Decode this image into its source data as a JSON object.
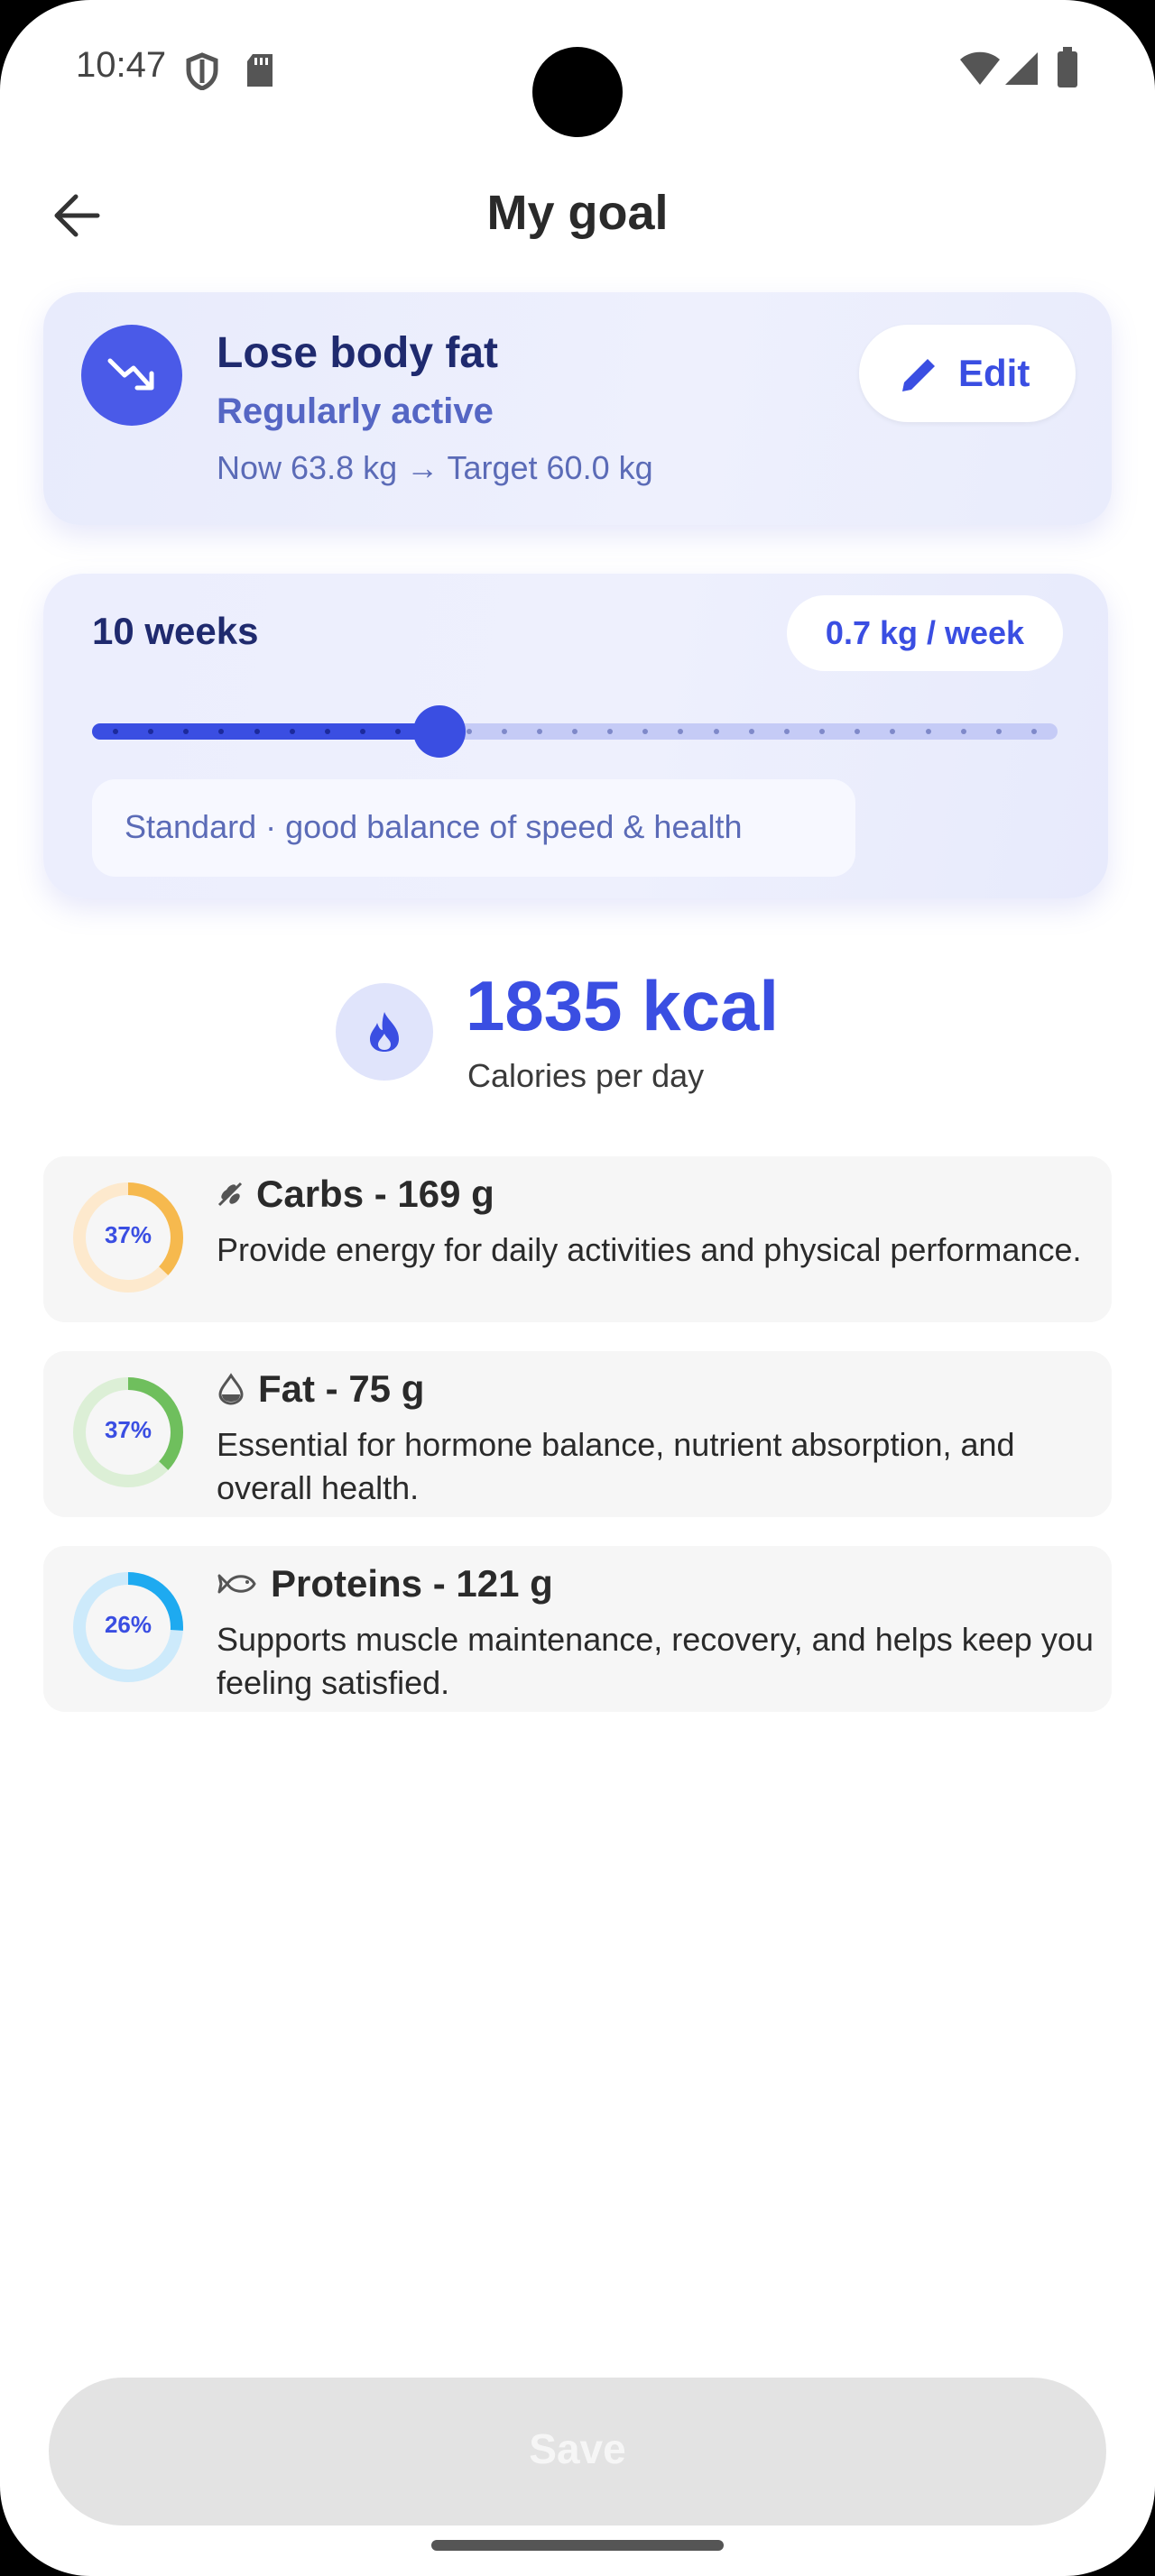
{
  "status_bar": {
    "time": "10:47"
  },
  "header": {
    "title": "My goal"
  },
  "goal": {
    "title": "Lose body fat",
    "activity": "Regularly active",
    "weights": "Now 63.8 kg  →  Target 60.0 kg",
    "edit_label": "Edit"
  },
  "plan": {
    "weeks_label": "10 weeks",
    "rate_label": "0.7 kg / week",
    "slider_fraction": 0.36,
    "note": "Standard · good balance of speed & health"
  },
  "calories": {
    "value": "1835 kcal",
    "label": "Calories per day"
  },
  "macros": [
    {
      "title": "Carbs - 169 g",
      "desc": "Provide energy for daily activities and physical performance.",
      "pct_label": "37%",
      "pct": 37,
      "color": "#f6b94e",
      "track": "#fde9cd",
      "icon": "wheat-icon"
    },
    {
      "title": "Fat - 75 g",
      "desc": "Essential for hormone balance, nutrient absorption, and overall health.",
      "pct_label": "37%",
      "pct": 37,
      "color": "#6fbf5d",
      "track": "#dcefd6",
      "icon": "drop-icon"
    },
    {
      "title": "Proteins - 121 g",
      "desc": "Supports muscle maintenance, recovery, and helps keep you feeling satisfied.",
      "pct_label": "26%",
      "pct": 26,
      "color": "#1eaaf0",
      "track": "#cdeafb",
      "icon": "fish-icon"
    }
  ],
  "save_label": "Save",
  "colors": {
    "accent": "#3a4ee2",
    "card_tint": "#eceefd"
  }
}
